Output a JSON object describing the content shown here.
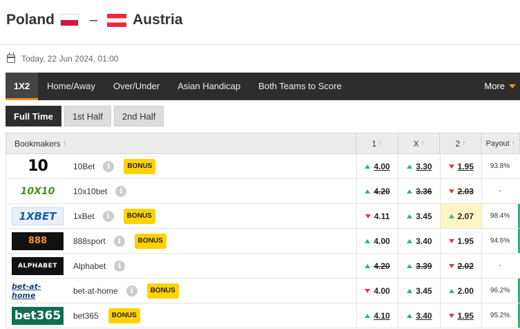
{
  "match": {
    "home": "Poland",
    "sep": "–",
    "away": "Austria",
    "date": "Today, 22 Jun 2024, 01:00"
  },
  "market_tabs": [
    "1X2",
    "Home/Away",
    "Over/Under",
    "Asian Handicap",
    "Both Teams to Score"
  ],
  "more_label": "More",
  "period_tabs": [
    "Full Time",
    "1st Half",
    "2nd Half"
  ],
  "table": {
    "headers": {
      "book": "Bookmakers",
      "c1": "1",
      "cx": "X",
      "c2": "2",
      "payout": "Payout"
    },
    "rows": [
      {
        "logo": "10",
        "name": "10Bet",
        "bonus": "BONUS",
        "o1": "4.00",
        "ox": "3.30",
        "o2": "1.95",
        "payout": "93.8%"
      },
      {
        "logo": "10X10",
        "name": "10x10bet",
        "bonus": "",
        "o1": "4.20",
        "ox": "3.36",
        "o2": "2.03",
        "payout": "-"
      },
      {
        "logo": "1XBET",
        "name": "1xBet",
        "bonus": "BONUS",
        "o1": "4.11",
        "ox": "3.45",
        "o2": "2.07",
        "payout": "98.4%"
      },
      {
        "logo": "888",
        "name": "888sport",
        "bonus": "BONUS",
        "o1": "4.00",
        "ox": "3.40",
        "o2": "1.95",
        "payout": "94.6%"
      },
      {
        "logo": "ALPHABET",
        "name": "Alphabet",
        "bonus": "",
        "o1": "4.20",
        "ox": "3.39",
        "o2": "2.02",
        "payout": "-"
      },
      {
        "logo": "bet-at-home",
        "name": "bet-at-home",
        "bonus": "BONUS",
        "o1": "4.00",
        "ox": "3.45",
        "o2": "2.00",
        "payout": "96.2%"
      },
      {
        "logo": "bet365",
        "name": "bet365",
        "bonus": "BONUS",
        "o1": "4.10",
        "ox": "3.40",
        "o2": "1.95",
        "payout": "95.2%"
      }
    ]
  },
  "colors": {
    "accent": "#f7941d",
    "up": "#2eb37a",
    "down": "#e03a3a",
    "bonus": "#ffd200"
  }
}
